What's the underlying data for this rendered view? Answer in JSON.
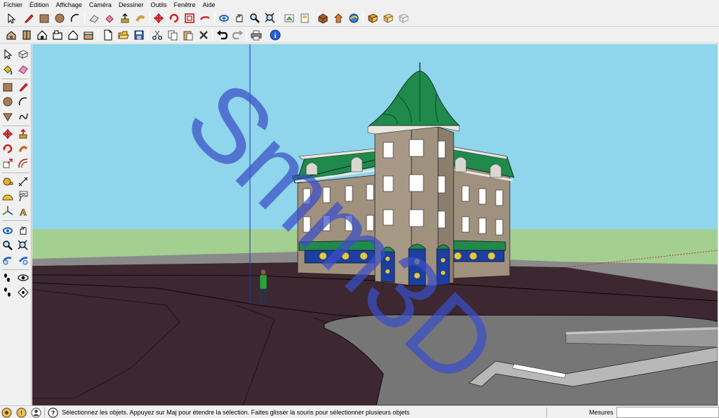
{
  "menu": [
    {
      "label": "Fichier"
    },
    {
      "label": "Édition"
    },
    {
      "label": "Affichage"
    },
    {
      "label": "Caméra"
    },
    {
      "label": "Dessiner"
    },
    {
      "label": "Outils"
    },
    {
      "label": "Fenêtre"
    },
    {
      "label": "Aide"
    }
  ],
  "toolbar1": [
    "select-icon",
    "pencil-icon",
    "rectangle-icon",
    "circle-icon",
    "arc-icon",
    "eraser-icon",
    "paint-bucket-icon",
    "push-pull-icon",
    "follow-me-icon",
    "move-icon",
    "rotate-icon",
    "offset-icon",
    "orbit-icon",
    "pan-icon",
    "zoom-icon",
    "zoom-extents-icon",
    "position-camera-icon",
    "walk-icon",
    "look-around-icon",
    "components-icon",
    "get-models-icon",
    "share-model-icon",
    "section-plane-icon",
    "display-section-icon"
  ],
  "toolbar2": [
    "iso-view-icon",
    "top-view-icon",
    "front-view-icon",
    "right-view-icon",
    "back-view-icon",
    "left-view-icon",
    "new-file-icon",
    "open-file-icon",
    "save-icon",
    "cut-icon",
    "copy-icon",
    "paste-icon",
    "delete-icon",
    "undo-icon",
    "redo-icon",
    "print-icon",
    "model-info-icon"
  ],
  "palette": [
    "select-icon",
    "make-component-icon",
    "paint-bucket-icon",
    "eraser-icon",
    "rectangle-icon",
    "line-icon",
    "circle-icon",
    "arc-icon",
    "polygon-icon",
    "freehand-icon",
    "move-icon",
    "push-pull-icon",
    "rotate-icon",
    "follow-me-icon",
    "scale-icon",
    "offset-icon",
    "tape-measure-icon",
    "dimension-icon",
    "protractor-icon",
    "text-icon",
    "axes-icon",
    "3d-text-icon",
    "orbit-icon",
    "pan-icon",
    "zoom-icon",
    "zoom-window-icon",
    "previous-view-icon",
    "zoom-extents-icon",
    "position-camera-icon",
    "look-around-icon",
    "walk-icon",
    "section-plane-icon"
  ],
  "watermark": "Smm3D",
  "status": {
    "text": "Sélectionnez les objets. Appuyez sur Maj pour étendre la sélection. Faites glisser la souris pour sélectionner plusieurs objets",
    "measures_label": "Mesures",
    "measures_value": ""
  },
  "colors": {
    "sky": "#8fd5ec",
    "grass": "#a3cf90",
    "ground_dark": "#3d2730",
    "road": "#767676",
    "facade": "#a0917e",
    "roof": "#1f8a4c",
    "awning_panel": "#1c3fa0",
    "watermark": "#3a4fc8"
  }
}
